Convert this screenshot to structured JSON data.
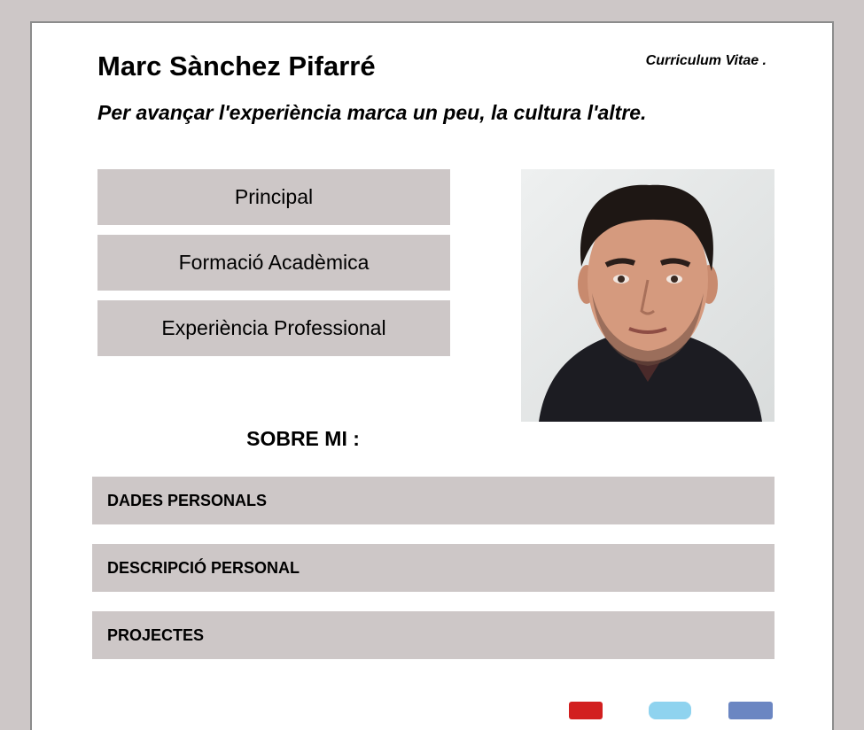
{
  "header": {
    "name": "Marc Sànchez Pifarré",
    "cv_label": "Curriculum Vitae .",
    "motto": "Per avançar l'experiència marca un peu, la cultura l'altre."
  },
  "nav": {
    "items": [
      {
        "label": "Principal"
      },
      {
        "label": "Formació Acadèmica"
      },
      {
        "label": "Experiència Professional"
      }
    ]
  },
  "about": {
    "title": "SOBRE MI :",
    "sections": [
      {
        "label": "DADES PERSONALS"
      },
      {
        "label": "DESCRIPCIÓ PERSONAL"
      },
      {
        "label": "PROJECTES"
      }
    ]
  },
  "footer_icons": [
    {
      "icon": "pdf-icon",
      "color": "#d21f1f"
    },
    {
      "icon": "twitter-icon",
      "color": "#8fd3ef"
    },
    {
      "icon": "facebook-icon",
      "color": "#6b86c2"
    }
  ],
  "colors": {
    "background": "#cdc7c7",
    "panel": "#ffffff",
    "button": "#cdc7c7"
  }
}
